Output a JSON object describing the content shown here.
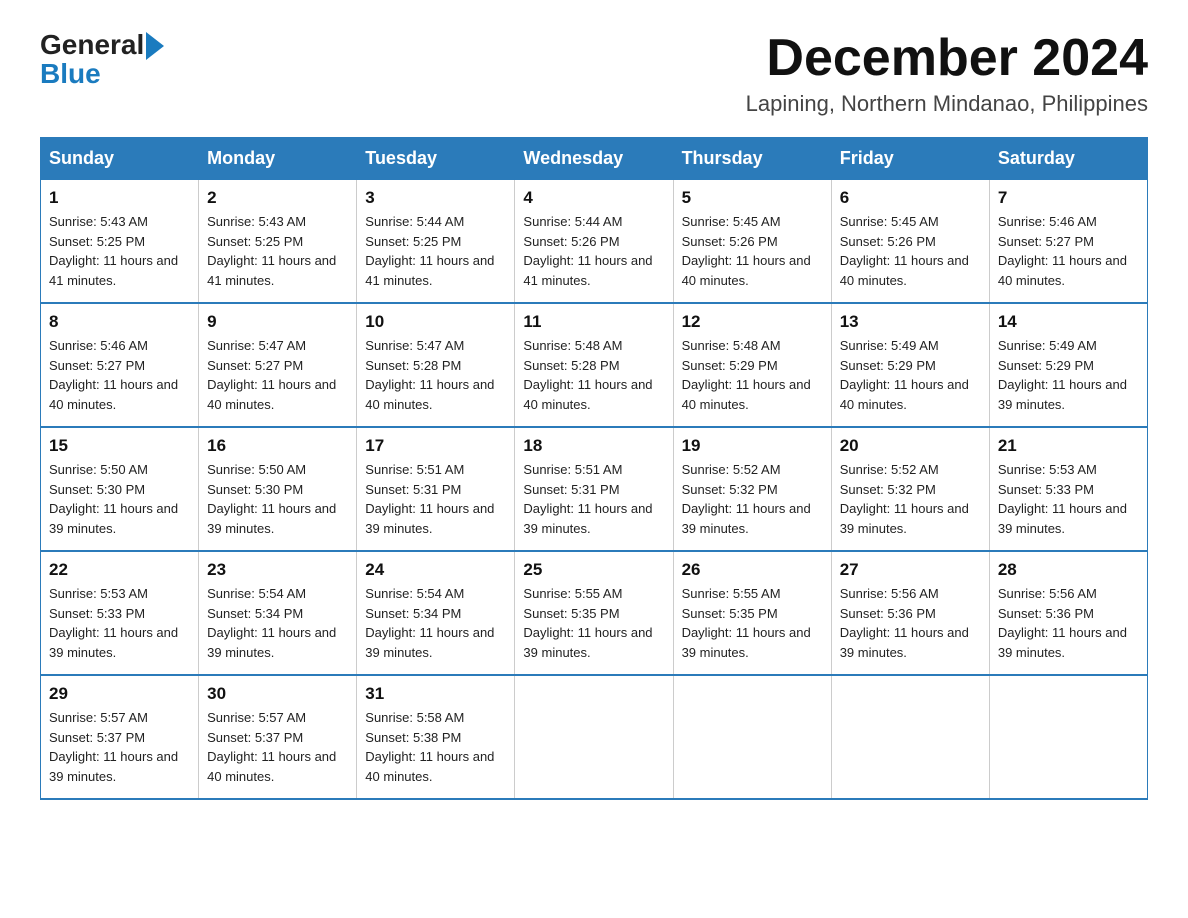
{
  "header": {
    "logo_general": "General",
    "logo_blue": "Blue",
    "month_title": "December 2024",
    "location": "Lapining, Northern Mindanao, Philippines"
  },
  "calendar": {
    "headers": [
      "Sunday",
      "Monday",
      "Tuesday",
      "Wednesday",
      "Thursday",
      "Friday",
      "Saturday"
    ],
    "weeks": [
      [
        {
          "day": "1",
          "sunrise": "5:43 AM",
          "sunset": "5:25 PM",
          "daylight": "11 hours and 41 minutes."
        },
        {
          "day": "2",
          "sunrise": "5:43 AM",
          "sunset": "5:25 PM",
          "daylight": "11 hours and 41 minutes."
        },
        {
          "day": "3",
          "sunrise": "5:44 AM",
          "sunset": "5:25 PM",
          "daylight": "11 hours and 41 minutes."
        },
        {
          "day": "4",
          "sunrise": "5:44 AM",
          "sunset": "5:26 PM",
          "daylight": "11 hours and 41 minutes."
        },
        {
          "day": "5",
          "sunrise": "5:45 AM",
          "sunset": "5:26 PM",
          "daylight": "11 hours and 40 minutes."
        },
        {
          "day": "6",
          "sunrise": "5:45 AM",
          "sunset": "5:26 PM",
          "daylight": "11 hours and 40 minutes."
        },
        {
          "day": "7",
          "sunrise": "5:46 AM",
          "sunset": "5:27 PM",
          "daylight": "11 hours and 40 minutes."
        }
      ],
      [
        {
          "day": "8",
          "sunrise": "5:46 AM",
          "sunset": "5:27 PM",
          "daylight": "11 hours and 40 minutes."
        },
        {
          "day": "9",
          "sunrise": "5:47 AM",
          "sunset": "5:27 PM",
          "daylight": "11 hours and 40 minutes."
        },
        {
          "day": "10",
          "sunrise": "5:47 AM",
          "sunset": "5:28 PM",
          "daylight": "11 hours and 40 minutes."
        },
        {
          "day": "11",
          "sunrise": "5:48 AM",
          "sunset": "5:28 PM",
          "daylight": "11 hours and 40 minutes."
        },
        {
          "day": "12",
          "sunrise": "5:48 AM",
          "sunset": "5:29 PM",
          "daylight": "11 hours and 40 minutes."
        },
        {
          "day": "13",
          "sunrise": "5:49 AM",
          "sunset": "5:29 PM",
          "daylight": "11 hours and 40 minutes."
        },
        {
          "day": "14",
          "sunrise": "5:49 AM",
          "sunset": "5:29 PM",
          "daylight": "11 hours and 39 minutes."
        }
      ],
      [
        {
          "day": "15",
          "sunrise": "5:50 AM",
          "sunset": "5:30 PM",
          "daylight": "11 hours and 39 minutes."
        },
        {
          "day": "16",
          "sunrise": "5:50 AM",
          "sunset": "5:30 PM",
          "daylight": "11 hours and 39 minutes."
        },
        {
          "day": "17",
          "sunrise": "5:51 AM",
          "sunset": "5:31 PM",
          "daylight": "11 hours and 39 minutes."
        },
        {
          "day": "18",
          "sunrise": "5:51 AM",
          "sunset": "5:31 PM",
          "daylight": "11 hours and 39 minutes."
        },
        {
          "day": "19",
          "sunrise": "5:52 AM",
          "sunset": "5:32 PM",
          "daylight": "11 hours and 39 minutes."
        },
        {
          "day": "20",
          "sunrise": "5:52 AM",
          "sunset": "5:32 PM",
          "daylight": "11 hours and 39 minutes."
        },
        {
          "day": "21",
          "sunrise": "5:53 AM",
          "sunset": "5:33 PM",
          "daylight": "11 hours and 39 minutes."
        }
      ],
      [
        {
          "day": "22",
          "sunrise": "5:53 AM",
          "sunset": "5:33 PM",
          "daylight": "11 hours and 39 minutes."
        },
        {
          "day": "23",
          "sunrise": "5:54 AM",
          "sunset": "5:34 PM",
          "daylight": "11 hours and 39 minutes."
        },
        {
          "day": "24",
          "sunrise": "5:54 AM",
          "sunset": "5:34 PM",
          "daylight": "11 hours and 39 minutes."
        },
        {
          "day": "25",
          "sunrise": "5:55 AM",
          "sunset": "5:35 PM",
          "daylight": "11 hours and 39 minutes."
        },
        {
          "day": "26",
          "sunrise": "5:55 AM",
          "sunset": "5:35 PM",
          "daylight": "11 hours and 39 minutes."
        },
        {
          "day": "27",
          "sunrise": "5:56 AM",
          "sunset": "5:36 PM",
          "daylight": "11 hours and 39 minutes."
        },
        {
          "day": "28",
          "sunrise": "5:56 AM",
          "sunset": "5:36 PM",
          "daylight": "11 hours and 39 minutes."
        }
      ],
      [
        {
          "day": "29",
          "sunrise": "5:57 AM",
          "sunset": "5:37 PM",
          "daylight": "11 hours and 39 minutes."
        },
        {
          "day": "30",
          "sunrise": "5:57 AM",
          "sunset": "5:37 PM",
          "daylight": "11 hours and 40 minutes."
        },
        {
          "day": "31",
          "sunrise": "5:58 AM",
          "sunset": "5:38 PM",
          "daylight": "11 hours and 40 minutes."
        },
        null,
        null,
        null,
        null
      ]
    ]
  }
}
